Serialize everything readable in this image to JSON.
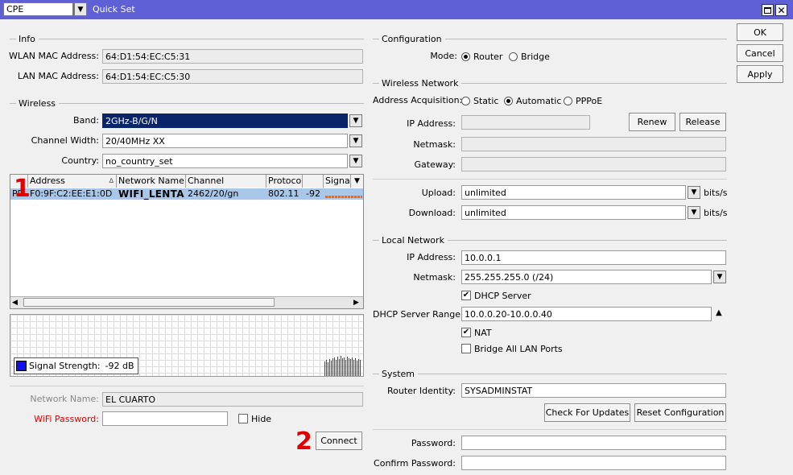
{
  "titlebar": {
    "mode_value": "CPE",
    "title": "Quick Set"
  },
  "dialog": {
    "ok": "OK",
    "cancel": "Cancel",
    "apply": "Apply"
  },
  "info": {
    "section": "Info",
    "wlan_mac_label": "WLAN MAC Address:",
    "wlan_mac": "64:D1:54:EC:C5:31",
    "lan_mac_label": "LAN MAC Address:",
    "lan_mac": "64:D1:54:EC:C5:30"
  },
  "wireless": {
    "section": "Wireless",
    "band_label": "Band:",
    "band": "2GHz-B/G/N",
    "width_label": "Channel Width:",
    "width": "20/40MHz XX",
    "country_label": "Country:",
    "country": "no_country_set"
  },
  "scan_table": {
    "columns": {
      "address": "Address",
      "network_name": "Network Name",
      "channel": "Channel",
      "protocol": "Protocol",
      "signal": "Signal S"
    },
    "rows": [
      {
        "flag": "PR",
        "address": "F0:9F:C2:EE:E1:0D",
        "network_name": "WIFI_LENTA",
        "channel": "2462/20/gn",
        "protocol": "802.11",
        "signal": "-92"
      }
    ]
  },
  "signal_graph": {
    "label": "Signal Strength:",
    "value": "-92 dB"
  },
  "connect": {
    "network_name_label": "Network Name:",
    "network_name": "EL CUARTO",
    "wifi_password_label": "WiFi Password:",
    "wifi_password": "",
    "hide_label": "Hide",
    "connect_button": "Connect"
  },
  "annotations": {
    "marker_1": "1",
    "marker_2": "2"
  },
  "configuration": {
    "section": "Configuration",
    "mode_label": "Mode:",
    "router": "Router",
    "bridge": "Bridge"
  },
  "wireless_network": {
    "section": "Wireless Network",
    "acq_label": "Address Acquisition:",
    "static": "Static",
    "automatic": "Automatic",
    "pppoe": "PPPoE",
    "ip_label": "IP Address:",
    "ip": "",
    "renew": "Renew",
    "release": "Release",
    "netmask_label": "Netmask:",
    "netmask": "",
    "gateway_label": "Gateway:",
    "gateway": "",
    "upload_label": "Upload:",
    "upload": "unlimited",
    "download_label": "Download:",
    "download": "unlimited",
    "unit": "bits/s"
  },
  "local_network": {
    "section": "Local Network",
    "ip_label": "IP Address:",
    "ip": "10.0.0.1",
    "netmask_label": "Netmask:",
    "netmask": "255.255.255.0 (/24)",
    "dhcp_server": "DHCP Server",
    "range_label": "DHCP Server Range:",
    "range": "10.0.0.20-10.0.0.40",
    "nat": "NAT",
    "bridge_all": "Bridge All LAN Ports"
  },
  "system": {
    "section": "System",
    "identity_label": "Router Identity:",
    "identity": "SYSADMINSTAT",
    "check_updates": "Check For Updates",
    "reset": "Reset Configuration",
    "password_label": "Password:",
    "password": "",
    "confirm_label": "Confirm Password:",
    "confirm": ""
  },
  "colors": {
    "titlebar": "#5f5fd6",
    "selected_row": "#a9c8e9",
    "band_field": "#0a246a",
    "annotation_red": "#e00000",
    "signal_bars": "#3b3bb8"
  }
}
